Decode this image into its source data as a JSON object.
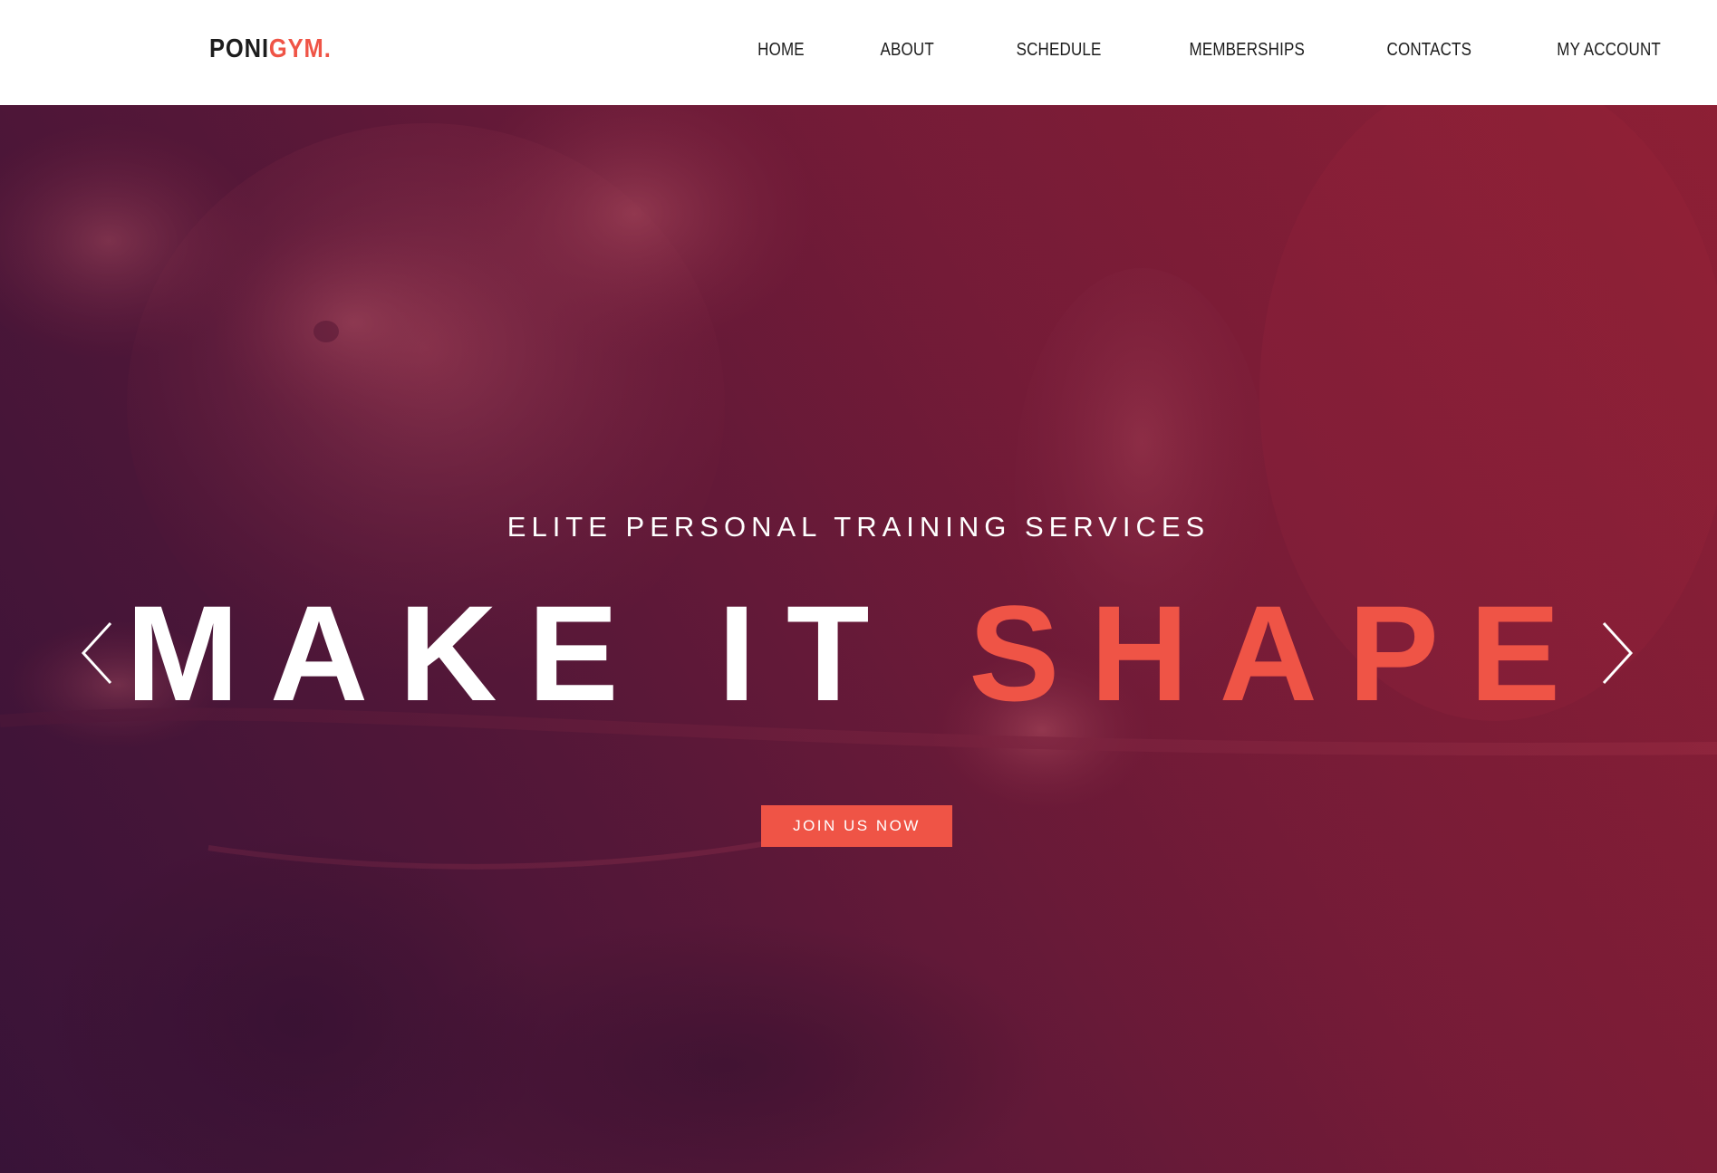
{
  "header": {
    "logo": {
      "part1": "PONI",
      "part2": "GYM."
    },
    "nav": [
      {
        "label": "HOME"
      },
      {
        "label": "ABOUT"
      },
      {
        "label": "SCHEDULE"
      },
      {
        "label": "MEMBERSHIPS"
      },
      {
        "label": "CONTACTS"
      },
      {
        "label": "MY ACCOUNT"
      }
    ]
  },
  "hero": {
    "subtitle": "ELITE PERSONAL TRAINING SERVICES",
    "headline": {
      "part1": "MAKE IT",
      "part2": "SHAPE"
    },
    "cta_label": "JOIN US NOW",
    "prev_icon": "chevron-left-icon",
    "next_icon": "chevron-right-icon"
  },
  "colors": {
    "accent": "#ef5446",
    "text_dark": "#1d1d1d",
    "hero_overlay_dark": "#3a1438",
    "hero_overlay_red": "#8e2036"
  }
}
